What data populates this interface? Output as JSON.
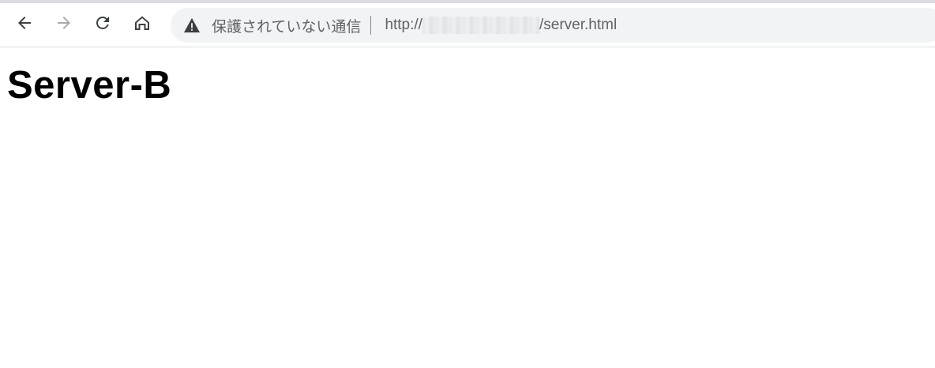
{
  "browser": {
    "nav": {
      "back_icon": "arrow-left-icon",
      "forward_icon": "arrow-right-icon",
      "reload_icon": "reload-icon",
      "home_icon": "home-icon"
    },
    "omnibox": {
      "security_icon": "warning-triangle-icon",
      "security_label": "保護されていない通信",
      "url_scheme": "http://",
      "url_path": "/server.html"
    },
    "colors": {
      "toolbar_bg": "#ffffff",
      "omnibox_bg": "#f1f3f4",
      "icon_active": "#3c4043",
      "icon_disabled": "#a8acb0"
    }
  },
  "page": {
    "heading": "Server-B"
  }
}
